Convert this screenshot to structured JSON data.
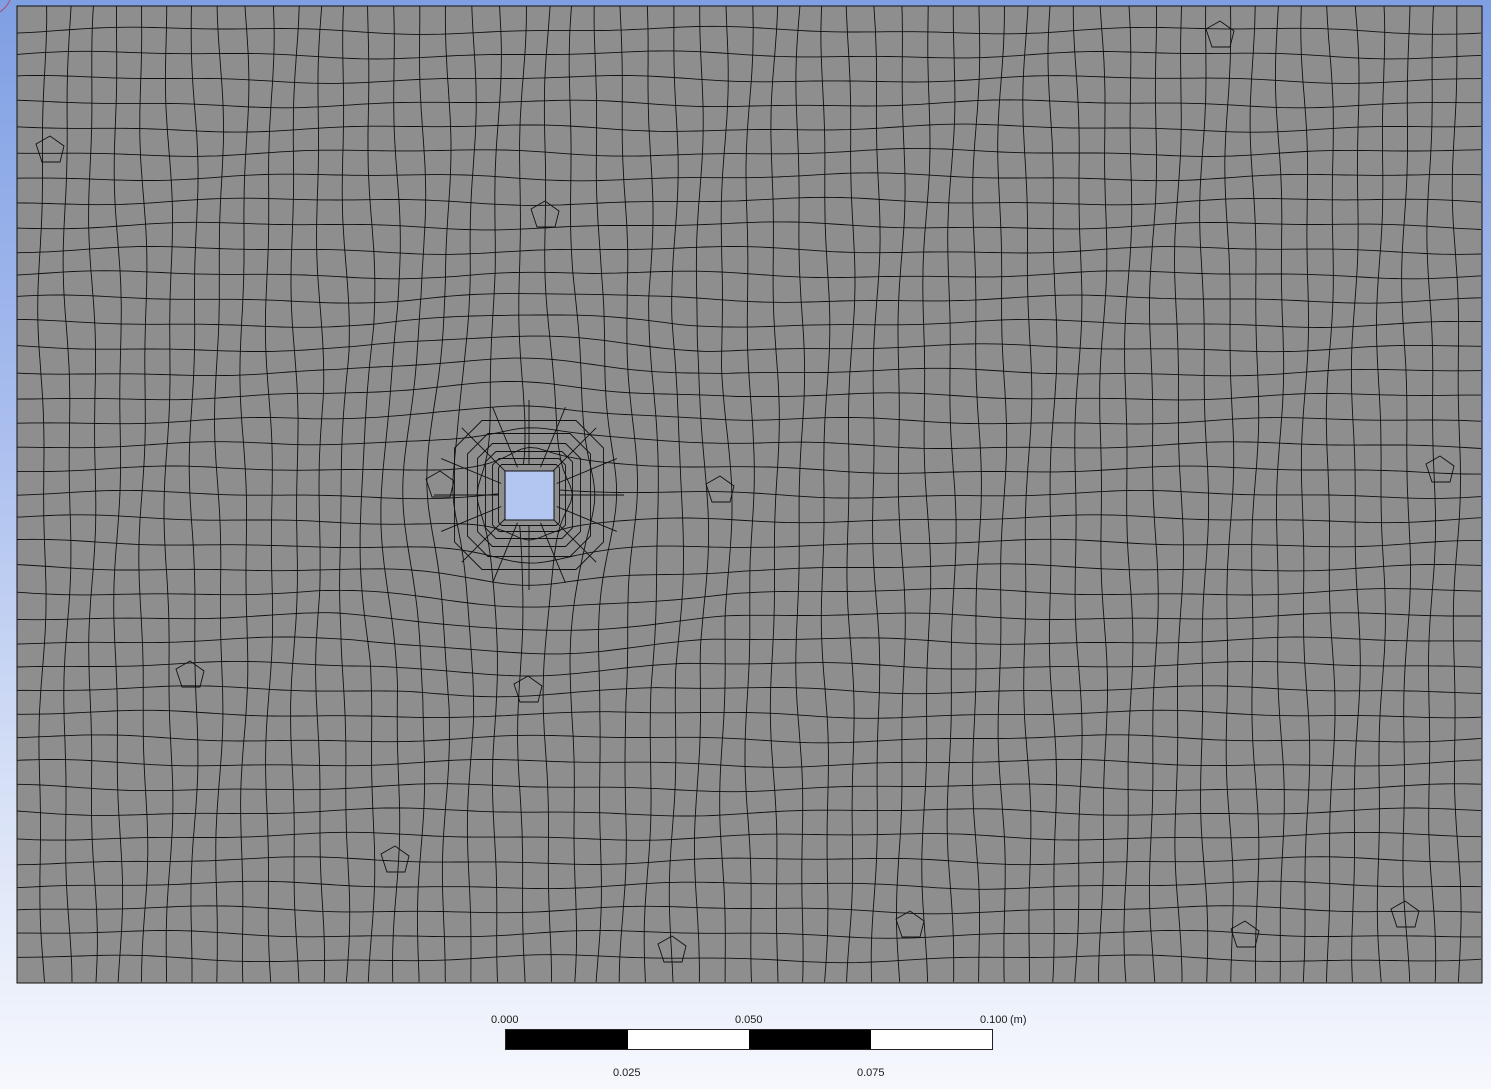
{
  "viewport": {
    "background_top": "#7f9fe3",
    "background_bottom": "#f6f8fd",
    "mesh_fill": "#8e8e8e",
    "mesh_line": "#101010",
    "hole_fill": "#b3c6f2"
  },
  "scale_bar": {
    "top_labels": [
      "0.000",
      "0.050",
      "0.100"
    ],
    "bottom_labels": [
      "0.025",
      "0.075"
    ],
    "unit": "(m)",
    "segments": [
      "dark",
      "light",
      "dark",
      "light"
    ]
  }
}
